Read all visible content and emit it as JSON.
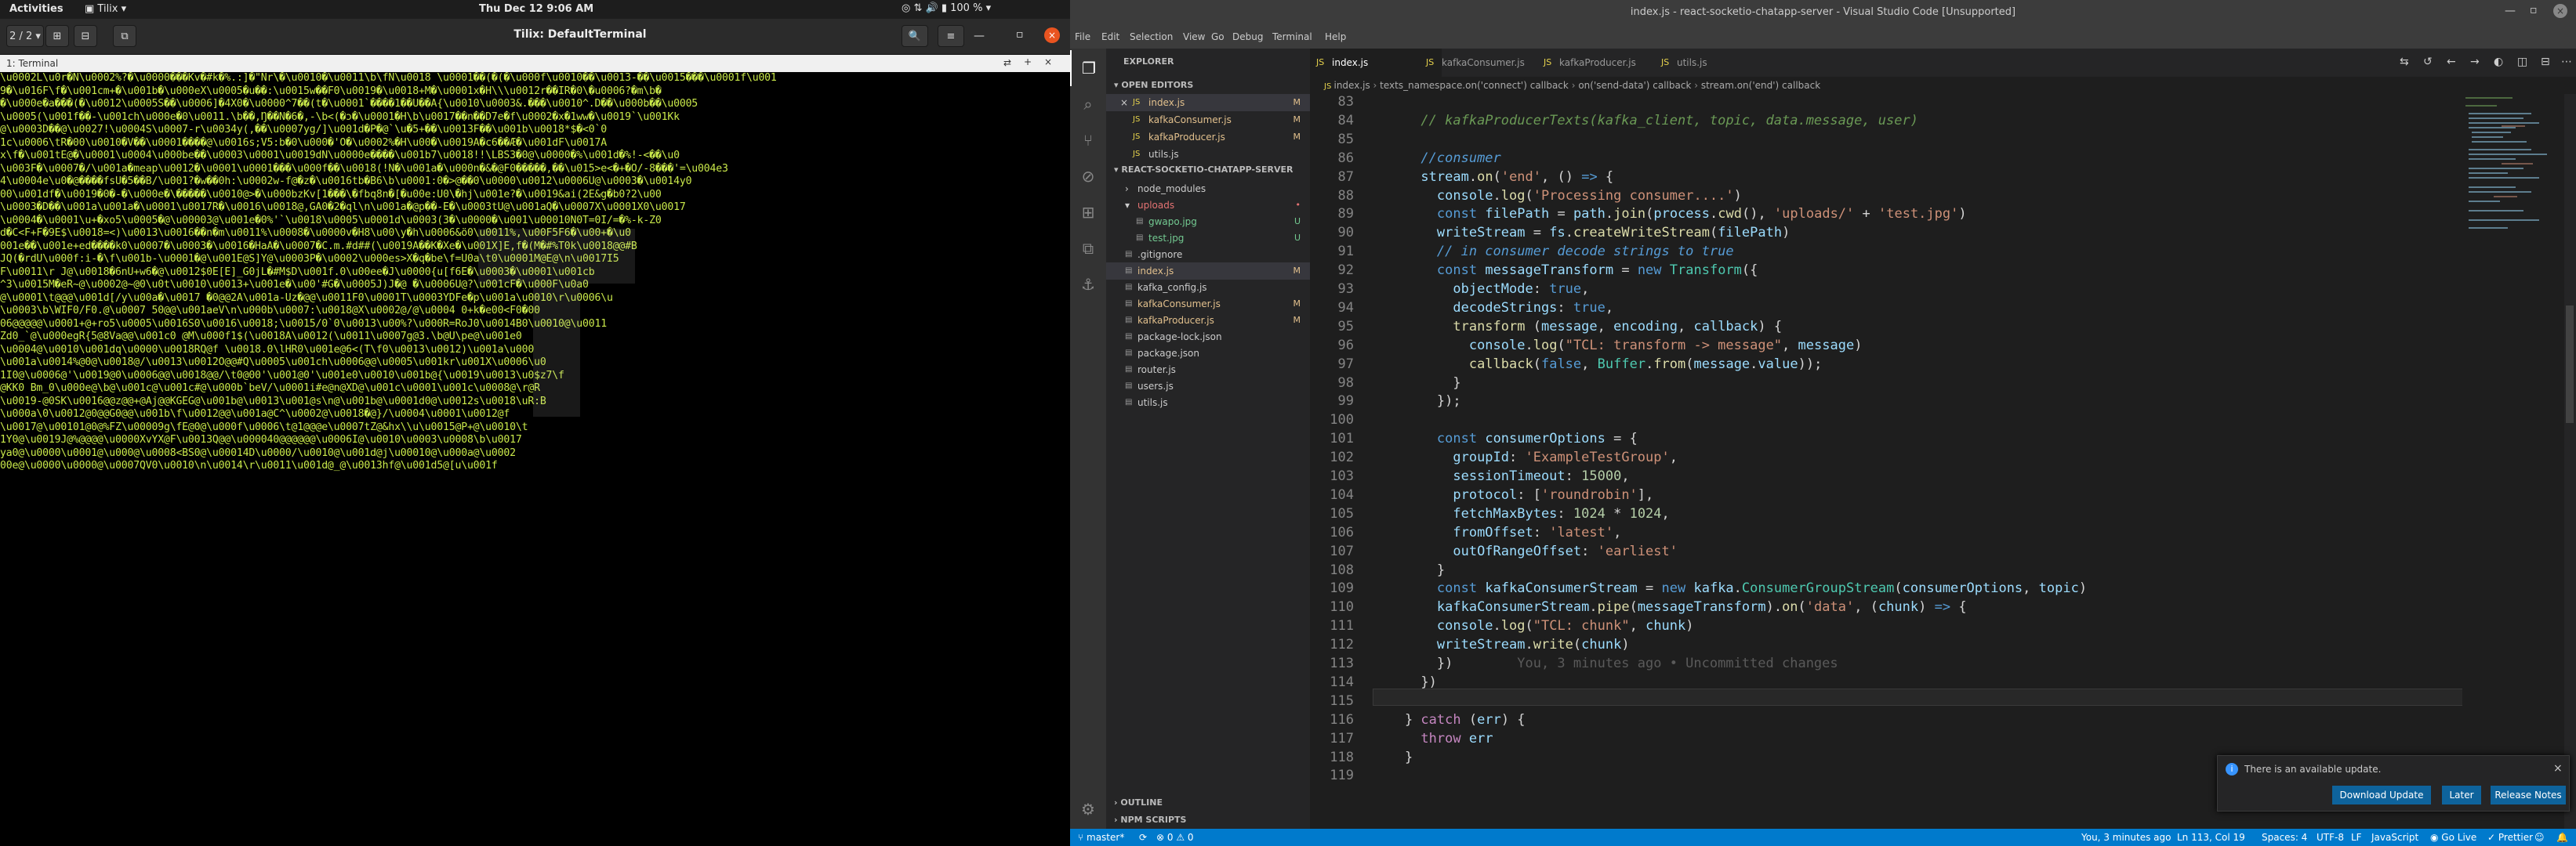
{
  "topbar": {
    "activities": "Activities",
    "app_menu": "Tilix",
    "clock": "Thu Dec 12 9:06 AM",
    "battery": "100 %"
  },
  "tilix": {
    "session_indicator": "2 / 2",
    "title": "Tilix: DefaultTerminal",
    "terminal_tab": "1: Terminal",
    "terminal_lines": [
      "\\u0002L\\u0r�N\\u0002%?�\\u0000���Kv�#k�%.:]�\"Nr\\�\\u0010�\\u0011\\b\\fN\\u0018 \\u0001��(�(�\\u000f\\u0010��\\u0013-��\\u0015���\\u0001f\\u001",
      "9�\\u016F\\f�\\u001cm+�\\u001b�\\u000eX\\u0005�u��:\\u0015w��F0\\u0019�\\u0018+M�\\u0001x�H\\\\\\u0012r��IR�0\\�u0006?�m\\b�",
      "�\\u000e�a���(�\\u0012\\u0005S��\\u0006]�4X0�\\u0000^7��(t�\\u0001`����1��U��A{\\u0010\\u0003&.���\\u0010^.D��\\u000b��\\u0005",
      "\\u0005(\\u001f��-\\u001ch\\u000e�0\\u0011.\\b��,Ŋ��N�6�,-\\b<(�ɔ�\\u0001�H\\b\\u0017��n��D7e�f\\u0002�x�1ww�\\u0019`\\u001Kk",
      "@\\u0003D��@\\u0027!\\u0004S\\u0007-r\\u0034y(,��\\u0007yg/]\\u001d�P�@`\\u�5+��\\u0013F��\\u001b\\u0018*$�<0`0",
      "1c\\u0006\\tR�00\\u0010�V��\\u0001����@\\u0016s;V5:b�0\\u000�'O�\\u0002%�H\\u00�\\u0019A�c6��Æ�\\u001dF\\u0017A",
      "x\\f�\\u001tE@�\\u0001\\u0004\\u000be��\\u0003\\u0001\\u0019dN\\u0000e����\\u001b7\\u0018!!\\LBS3�0@\\u0000�%\\u001d�%!-<��\\u0",
      "\\u003F�\\u0007�/\\u001a�meap\\u0012�\\u0001\\u0001���\\u000f��\\u0018(!N�\\u001a�\\u000n�&�@F0�����,��\\u015>e<�+�O/-8���'=\\u004e3",
      "4\\u0004e\\u0�@����fsU�5��B/\\u001?�w��0h:\\u0002w-f@�z�\\u0016tb�B6\\b\\u0001:0�>@��0\\u0000\\u0012\\u0006U@\\u0003�\\u0014y0",
      "00\\u001df�\\u0019�0�-�\\u000e�\\�����\\u0010@>�\\u000bzKv[1���\\�fbq8n�[�u00e:U0\\�hj\\u001e?�\\u0019&ai(2E&g�b0?2\\u00",
      "\\u0003�D��\\u001a\\u001a�\\u0001\\u0017R�\\u0016\\u0018@,GA0�2�ql\\n\\u001a�@p��-E�\\u0003tU@\\u001aQ�\\u0007X\\u0001X0\\u0017",
      "\\u0004�\\u0001\\u+�xo5\\u0005�@\\u00003@\\u001e�0%'`\\u0018\\u0005\\u0001d\\u0003(3�\\u0000�\\u001\\u00010N0T=0I/=�%-k-Z0",
      "d�C<F+F�9E$\\u0018=<)\\u0013\\u0016��n�m\\u0011%\\u0008�\\u0000v�H8\\u00\\y�h\\u0006&ö0\\u0011%,\\u00F5F6�\\u00+�\\u0",
      "001e��\\u001e+ed����k0\\u0007�\\u0003�\\u0016�HaA�\\u0007�C.m.#d##(\\u0019A��K�Xe�\\u001X]E,f�(M�#%T0k\\u0018@@#B",
      "JQ(�rdU\\u000f:i-�\\f\\u001b-\\u0001�@\\u001E@S]Y@\\u0003P�\\u0002\\u000es>X�q�be\\f=U0a\\t0\\u0001M@E@\\n\\u0017I5",
      "F\\u0011\\r J@\\u0018�6nU+w6�@\\u0012$0E[E]_G0jL�#M$D\\u001f.0\\u00ee�J\\u0000{u[f6E�\\u0003�\\u0001\\u001cb",
      "^3\\u0015M�eR~@\\u0002@~@0\\u0t\\u0010\\u0013+\\u001e�\\u00'#G�\\u0005J)J�@ �\\u0006U@?\\u001cF�\\u000F\\u0a0",
      "@\\u0001\\t@@@\\u001d[/y\\u00a�\\u0017 �0@@2A\\u001a-Uz�@@\\u0011F0\\u0001T\\u0003YDFe�p\\u001a\\u0010\\r\\u0006\\u",
      "\\u0003\\b\\WIF0/F0.@\\u0007 50@@\\u001aeV\\n\\u000b\\u0007:\\u0018@X\\u0002@/@\\u0004 0+k�e00<F0�00",
      "06@@@@@\\u0001+@+ro5\\u0005\\u0016S0\\u0016\\u0018;\\u0015/0`0\\u0013\\u00%?\\u000R=RoJ0\\u0014B0\\u0010@\\u0011",
      "Zd0_`@\\u000egR{5@8Va@@\\u001c0 @M\\u000f1$(\\u0018A\\u0012(\\u0011\\u0007g@3.\\b@U\\pe@\\u001e0",
      "\\u0004@\\u0010\\u001dq\\u0000\\u0018RQ@f \\u0018.0\\lHR0\\u001e@6<(T\\f0\\u0013\\u0012)\\u001a\\u000",
      "\\u001a\\u0014%@0@\\u0018@/\\u0013\\u0012O@@#Q\\u0005\\u001ch\\u0006@@\\u0005\\u001kr\\u001X\\u0006\\u0",
      "1I0@\\u0006@'\\u0019@0\\u0006@@\\u0018@@/\\t0@00'\\u001@0'\\u001e0\\u0010\\u001b@{\\u0019\\u0013\\u0$z7\\f",
      "@KK0 Bm_0\\u000e@\\b@\\u001c@\\u001c#@\\u000b`beV/\\u0001i#e@n@XD@\\u001c\\u0001\\u001c\\u0008@\\r@R",
      "\\u0019-@0SK\\u0016@@z@@+@Aj@@KGEG@\\u001b@\\u0013\\u001@s\\n@\\u001b@\\u0001d0@\\u0012s\\u0018\\uR:B",
      "\\u000a\\0\\u0012@0@@G0@@\\u001b\\f\\u0012@@\\u001a@C^\\u0002@\\u0018�@}/\\u0004\\u0001\\u0012@f",
      "\\u0017@\\u00101@0@%FZ\\u00009g\\fE@0@\\u000f\\u0006\\t@1@@@e\\u0007tZ@&hx\\\\u\\u0015@P+@\\u0010\\t",
      "1Y0@\\u0019J@%@@@@\\u0000XvYX@F\\u0013Q@@\\u000040@@@@@@\\u0006I@\\u0010\\u0003\\u0008\\b\\u0017",
      "ya0@\\u0000\\u0001@\\u000@\\u0008<BS0@\\u00014D\\u0000/\\u0010@\\u001d@j\\u00010@\\u000a@\\u0002",
      "00e@\\u0000\\u0000@\\u0007QV0\\u0010\\n\\u0014\\r\\u0011\\u001d@_@\\u0013hf@\\u001d5@[u\\u001f"
    ]
  },
  "vscode": {
    "window_title": "index.js - react-socketio-chatapp-server - Visual Studio Code [Unsupported]",
    "menu": [
      "File",
      "Edit",
      "Selection",
      "View",
      "Go",
      "Debug",
      "Terminal",
      "Help"
    ],
    "explorer": {
      "header": "EXPLORER",
      "open_editors_label": "OPEN EDITORS",
      "open_editors": [
        {
          "name": "index.js",
          "marker": "M",
          "color": "#e2c08d"
        },
        {
          "name": "kafkaConsumer.js",
          "marker": "M",
          "color": "#e2c08d"
        },
        {
          "name": "kafkaProducer.js",
          "marker": "M",
          "color": "#e2c08d"
        },
        {
          "name": "utils.js",
          "marker": "",
          "color": "#cccccc"
        }
      ],
      "project_label": "REACT-SOCKETIO-CHATAPP-SERVER",
      "tree": [
        {
          "name": "node_modules",
          "marker": "",
          "color": "#cccccc",
          "indent": 1,
          "folder": true
        },
        {
          "name": "uploads",
          "marker": "•",
          "color": "#e57373",
          "indent": 1,
          "folder": true
        },
        {
          "name": "gwapo.jpg",
          "marker": "U",
          "color": "#73c991",
          "indent": 2
        },
        {
          "name": "test.jpg",
          "marker": "U",
          "color": "#73c991",
          "indent": 2
        },
        {
          "name": ".gitignore",
          "marker": "",
          "color": "#cccccc",
          "indent": 1
        },
        {
          "name": "index.js",
          "marker": "M",
          "color": "#e2c08d",
          "indent": 1
        },
        {
          "name": "kafka_config.js",
          "marker": "",
          "color": "#cccccc",
          "indent": 1
        },
        {
          "name": "kafkaConsumer.js",
          "marker": "M",
          "color": "#e2c08d",
          "indent": 1
        },
        {
          "name": "kafkaProducer.js",
          "marker": "M",
          "color": "#e2c08d",
          "indent": 1
        },
        {
          "name": "package-lock.json",
          "marker": "",
          "color": "#cccccc",
          "indent": 1
        },
        {
          "name": "package.json",
          "marker": "",
          "color": "#cccccc",
          "indent": 1
        },
        {
          "name": "router.js",
          "marker": "",
          "color": "#cccccc",
          "indent": 1
        },
        {
          "name": "users.js",
          "marker": "",
          "color": "#cccccc",
          "indent": 1
        },
        {
          "name": "utils.js",
          "marker": "",
          "color": "#cccccc",
          "indent": 1
        }
      ],
      "outline_label": "OUTLINE",
      "npm_label": "NPM SCRIPTS"
    },
    "tabs": [
      "index.js",
      "kafkaConsumer.js",
      "kafkaProducer.js",
      "utils.js"
    ],
    "breadcrumbs": [
      "index.js",
      "texts_namespace.on('connect') callback",
      "on('send-data') callback",
      "stream.on('end') callback"
    ],
    "code_lines": [
      {
        "n": "83",
        "html": ""
      },
      {
        "n": "84",
        "html": "      <span class='cmt'>// kafkaProducerTexts(kafka_client, topic, data.message, user)</span>"
      },
      {
        "n": "85",
        "html": ""
      },
      {
        "n": "86",
        "html": "      <span class='cm2'>//consumer</span>"
      },
      {
        "n": "87",
        "html": "      <span class='var'>stream</span>.<span class='fn'>on</span>(<span class='str'>'end'</span>, () <span class='kw'>=&gt;</span> {"
      },
      {
        "n": "88",
        "html": "        <span class='var'>console</span>.<span class='fn'>log</span>(<span class='str'>'Processing consumer....'</span>)"
      },
      {
        "n": "89",
        "html": "        <span class='kw'>const</span> <span class='var'>filePath</span> = <span class='var'>path</span>.<span class='fn'>join</span>(<span class='var'>process</span>.<span class='fn'>cwd</span>(), <span class='str'>'uploads/'</span> + <span class='str'>'test.jpg'</span>)"
      },
      {
        "n": "90",
        "html": "        <span class='var'>writeStream</span> = <span class='var'>fs</span>.<span class='fn'>createWriteStream</span>(<span class='var'>filePath</span>)"
      },
      {
        "n": "91",
        "html": "        <span class='cm2'>// in consumer decode strings to true</span>"
      },
      {
        "n": "92",
        "html": "        <span class='kw'>const</span> <span class='var'>messageTransform</span> = <span class='kw'>new</span> <span class='cls'>Transform</span>({"
      },
      {
        "n": "93",
        "html": "          <span class='var'>objectMode</span>: <span class='kw'>true</span>,"
      },
      {
        "n": "94",
        "html": "          <span class='var'>decodeStrings</span>: <span class='kw'>true</span>,"
      },
      {
        "n": "95",
        "html": "          <span class='fn'>transform</span> (<span class='var'>message</span>, <span class='var'>encoding</span>, <span class='var'>callback</span>) {"
      },
      {
        "n": "96",
        "html": "            <span class='var'>console</span>.<span class='fn'>log</span>(<span class='str'>\"TCL: transform -&gt; message\"</span>, <span class='var'>message</span>)"
      },
      {
        "n": "97",
        "html": "            <span class='fn'>callback</span>(<span class='kw'>false</span>, <span class='cls'>Buffer</span>.<span class='fn'>from</span>(<span class='var'>message</span>.<span class='var'>value</span>));"
      },
      {
        "n": "98",
        "html": "          }"
      },
      {
        "n": "99",
        "html": "        });"
      },
      {
        "n": "100",
        "html": ""
      },
      {
        "n": "101",
        "html": "        <span class='kw'>const</span> <span class='var'>consumerOptions</span> = {"
      },
      {
        "n": "102",
        "html": "          <span class='var'>groupId</span>: <span class='str'>'ExampleTestGroup'</span>,"
      },
      {
        "n": "103",
        "html": "          <span class='var'>sessionTimeout</span>: <span class='num'>15000</span>,"
      },
      {
        "n": "104",
        "html": "          <span class='var'>protocol</span>: [<span class='str'>'roundrobin'</span>],"
      },
      {
        "n": "105",
        "html": "          <span class='var'>fetchMaxBytes</span>: <span class='num'>1024</span> * <span class='num'>1024</span>,"
      },
      {
        "n": "106",
        "html": "          <span class='var'>fromOffset</span>: <span class='str'>'latest'</span>,"
      },
      {
        "n": "107",
        "html": "          <span class='var'>outOfRangeOffset</span>: <span class='str'>'earliest'</span>"
      },
      {
        "n": "108",
        "html": "        }"
      },
      {
        "n": "109",
        "html": "        <span class='kw'>const</span> <span class='var'>kafkaConsumerStream</span> = <span class='kw'>new</span> <span class='var'>kafka</span>.<span class='cls'>ConsumerGroupStream</span>(<span class='var'>consumerOptions</span>, <span class='var'>topic</span>)"
      },
      {
        "n": "110",
        "html": "        <span class='var'>kafkaConsumerStream</span>.<span class='fn'>pipe</span>(<span class='var'>messageTransform</span>).<span class='fn'>on</span>(<span class='str'>'data'</span>, (<span class='var'>chunk</span>) <span class='kw'>=&gt;</span> {"
      },
      {
        "n": "111",
        "html": "        <span class='var'>console</span>.<span class='fn'>log</span>(<span class='str'>\"TCL: chunk\"</span>, <span class='var'>chunk</span>)"
      },
      {
        "n": "112",
        "html": "        <span class='var'>writeStream</span>.<span class='fn'>write</span>(<span class='var'>chunk</span>)"
      },
      {
        "n": "113",
        "html": "        })<span style='color:#5a5a5a'>        You, 3 minutes ago • Uncommitted changes</span>"
      },
      {
        "n": "114",
        "html": "      })"
      },
      {
        "n": "115",
        "html": ""
      },
      {
        "n": "116",
        "html": "    } <span class='kwc'>catch</span> (<span class='var'>err</span>) {"
      },
      {
        "n": "117",
        "html": "      <span class='kwc'>throw</span> <span class='var'>err</span>"
      },
      {
        "n": "118",
        "html": "    }"
      },
      {
        "n": "119",
        "html": ""
      }
    ],
    "notification": {
      "message": "There is an available update.",
      "buttons": [
        "Download Update",
        "Later",
        "Release Notes"
      ]
    },
    "statusbar": {
      "branch": "master*",
      "problems": "⊗ 0 ⚠ 0",
      "blame": "You, 3 minutes ago",
      "position": "Ln 113, Col 19",
      "spaces": "Spaces: 4",
      "encoding": "UTF-8",
      "eol": "LF",
      "language": "JavaScript",
      "golive": "Go Live",
      "prettier": "Prettier"
    }
  }
}
